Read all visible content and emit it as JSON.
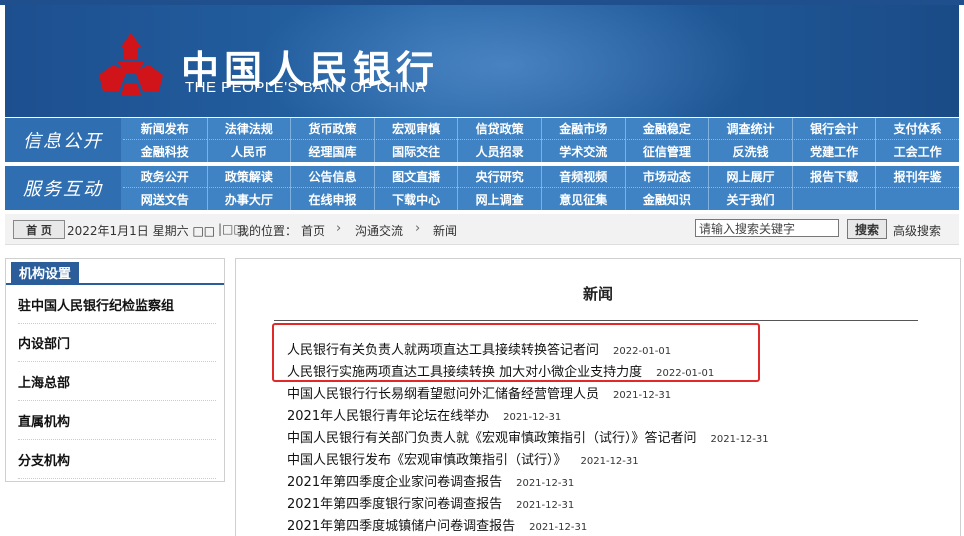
{
  "banner": {
    "cn_name": "中国人民银行",
    "en_name": "THE PEOPLE'S BANK OF CHINA",
    "logo_icon": "pboc-emblem-icon",
    "colors": {
      "banner": "#1d4f8f",
      "nav": "#3f83c4",
      "logo": "#d0141a"
    }
  },
  "nav": {
    "section1_label": "信息公开",
    "section1_items": [
      "新闻发布",
      "法律法规",
      "货币政策",
      "宏观审慎",
      "信贷政策",
      "金融市场",
      "金融稳定",
      "调查统计",
      "银行会计",
      "支付体系",
      "金融科技",
      "人民币",
      "经理国库",
      "国际交往",
      "人员招录",
      "学术交流",
      "征信管理",
      "反洗钱",
      "党建工作",
      "工会工作"
    ],
    "section2_label": "服务互动",
    "section2_items": [
      "政务公开",
      "政策解读",
      "公告信息",
      "图文直播",
      "央行研究",
      "音频视频",
      "市场动态",
      "网上展厅",
      "报告下载",
      "报刊年鉴",
      "网送文告",
      "办事大厅",
      "在线申报",
      "下载中心",
      "网上调查",
      "意见征集",
      "金融知识",
      "关于我们",
      "",
      ""
    ]
  },
  "crumbbar": {
    "home_button": "首 页",
    "date": "2022年1月1日 星期六 □□",
    "separator": "|□□",
    "location_label": "我的位置：",
    "crumbs": [
      "首页",
      "沟通交流",
      "新闻"
    ],
    "search_placeholder": "请输入搜索关键字",
    "search_button": "搜索",
    "advanced_search": "高级搜索"
  },
  "sidebar": {
    "title": "机构设置",
    "items": [
      "驻中国人民银行纪检监察组",
      "内设部门",
      "上海总部",
      "直属机构",
      "分支机构"
    ]
  },
  "main": {
    "title": "新闻",
    "news": [
      {
        "title": "人民银行有关负责人就两项直达工具接续转换答记者问",
        "date": "2022-01-01"
      },
      {
        "title": "人民银行实施两项直达工具接续转换 加大对小微企业支持力度",
        "date": "2022-01-01"
      },
      {
        "title": "中国人民银行行长易纲看望慰问外汇储备经营管理人员",
        "date": "2021-12-31"
      },
      {
        "title": "2021年人民银行青年论坛在线举办",
        "date": "2021-12-31"
      },
      {
        "title": "中国人民银行有关部门负责人就《宏观审慎政策指引（试行）》答记者问",
        "date": "2021-12-31"
      },
      {
        "title": "中国人民银行发布《宏观审慎政策指引（试行）》",
        "date": "2021-12-31"
      },
      {
        "title": "2021年第四季度企业家问卷调查报告",
        "date": "2021-12-31"
      },
      {
        "title": "2021年第四季度银行家问卷调查报告",
        "date": "2021-12-31"
      },
      {
        "title": "2021年第四季度城镇储户问卷调查报告",
        "date": "2021-12-31"
      }
    ],
    "highlight_color": "#e02a2a"
  }
}
